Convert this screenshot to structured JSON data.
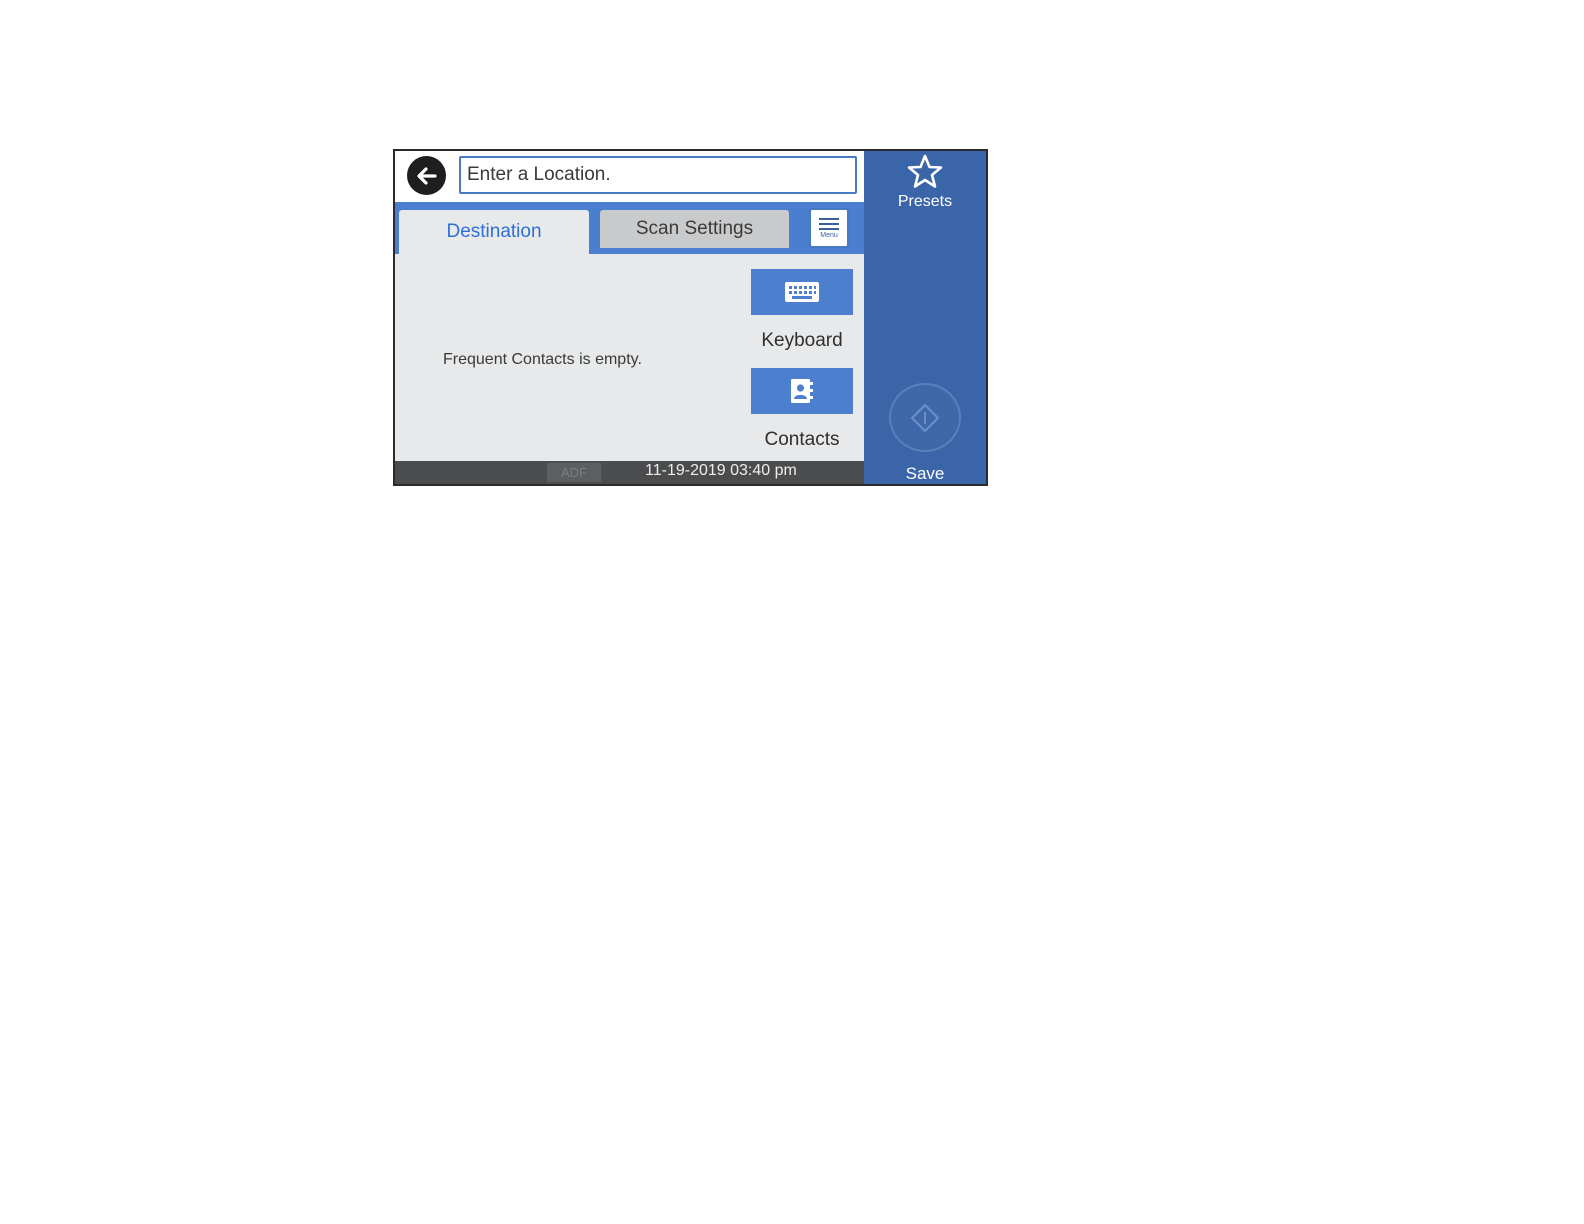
{
  "header": {
    "back_icon": "arrow-left-icon",
    "location_placeholder": "Enter a Location."
  },
  "tabs": [
    {
      "label": "Destination",
      "active": true
    },
    {
      "label": "Scan Settings",
      "active": false
    }
  ],
  "menu": {
    "label": "Menu",
    "icon": "hamburger-menu-icon"
  },
  "content": {
    "empty_message": "Frequent Contacts is empty.",
    "keyboard": {
      "label": "Keyboard",
      "icon": "keyboard-icon"
    },
    "contacts": {
      "label": "Contacts",
      "icon": "address-book-icon"
    }
  },
  "status": {
    "adf": "ADF",
    "datetime": "11-19-2019 03:40 pm"
  },
  "sidebar": {
    "presets": {
      "label": "Presets",
      "icon": "star-icon"
    },
    "save": {
      "label": "Save",
      "icon": "start-diamond-icon"
    }
  },
  "colors": {
    "tab_bar": "#4a7fd0",
    "sidebar": "#3a65a8",
    "active_tab_text": "#2e6fd8",
    "content_bg": "#e7e9eb",
    "status_bar": "#4b4c4e"
  }
}
